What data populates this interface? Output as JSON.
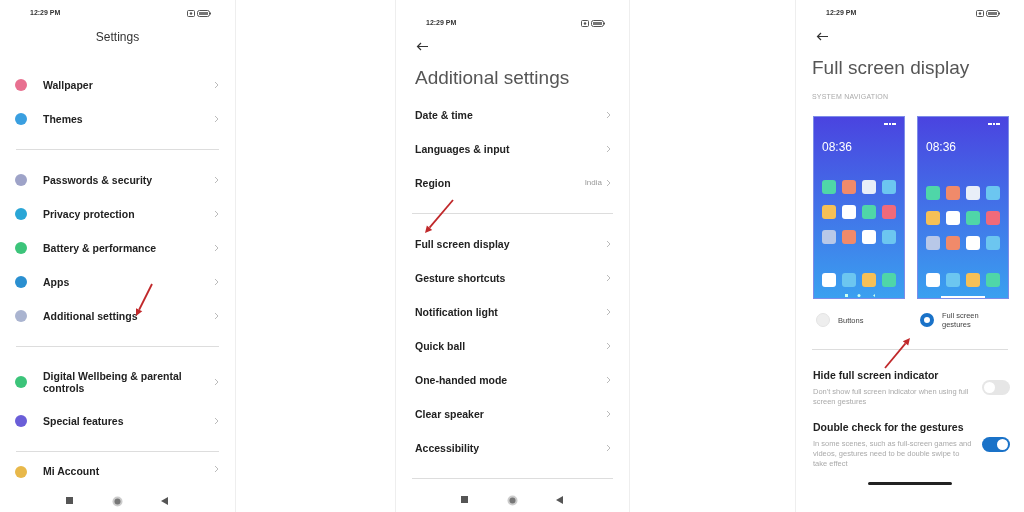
{
  "settings_screen": {
    "status_time": "12:29 PM",
    "title": "Settings",
    "groups": [
      {
        "items": [
          {
            "label": "Wallpaper",
            "color": "#e87090",
            "annotated": false
          },
          {
            "label": "Themes",
            "color": "#3a9fe0",
            "annotated": false
          }
        ]
      },
      {
        "items": [
          {
            "label": "Passwords & security",
            "color": "#9ea3c8",
            "annotated": false
          },
          {
            "label": "Privacy protection",
            "color": "#2aa6d6",
            "annotated": false
          },
          {
            "label": "Battery & performance",
            "color": "#3cc47a",
            "annotated": false
          },
          {
            "label": "Apps",
            "color": "#2a8fd0",
            "annotated": false
          },
          {
            "label": "Additional settings",
            "color": "#aab4d0",
            "annotated": true
          }
        ]
      },
      {
        "items": [
          {
            "label": "Digital Wellbeing & parental controls",
            "color": "#3cc47a",
            "annotated": false
          },
          {
            "label": "Special features",
            "color": "#6a5ed8",
            "annotated": false
          }
        ]
      },
      {
        "items": [
          {
            "label": "Mi Account",
            "color": "#e8b84a",
            "annotated": false
          }
        ]
      }
    ]
  },
  "additional_settings_screen": {
    "status_time": "12:29 PM",
    "title": "Additional settings",
    "groups": [
      {
        "items": [
          {
            "label": "Date & time",
            "annotated": false
          },
          {
            "label": "Languages & input",
            "annotated": false
          },
          {
            "label": "Region",
            "value": "India",
            "annotated": false
          }
        ]
      },
      {
        "items": [
          {
            "label": "Full screen display",
            "annotated": true
          },
          {
            "label": "Gesture shortcuts",
            "annotated": false
          },
          {
            "label": "Notification light",
            "annotated": false
          },
          {
            "label": "Quick ball",
            "annotated": false
          },
          {
            "label": "One-handed mode",
            "annotated": false
          },
          {
            "label": "Clear speaker",
            "annotated": false
          },
          {
            "label": "Accessibility",
            "annotated": false
          }
        ]
      }
    ]
  },
  "full_screen_display_screen": {
    "status_time": "12:29 PM",
    "title": "Full screen display",
    "section_label": "SYSTEM NAVIGATION",
    "options": [
      {
        "label": "Buttons",
        "selected": false,
        "annotated": false,
        "preview": {
          "kind": "buttons",
          "time": "08:36"
        }
      },
      {
        "label": "Full screen gestures",
        "selected": true,
        "annotated": true,
        "preview": {
          "kind": "gestures",
          "time": "08:36"
        }
      }
    ],
    "toggles": [
      {
        "title": "Hide full screen indicator",
        "description": "Don't show full screen indicator when using full screen gestures",
        "on": false
      },
      {
        "title": "Double check for the gestures",
        "description": "In some scenes, such as full-screen games and videos, gestures need to be double swipe to take effect",
        "on": true
      }
    ]
  }
}
